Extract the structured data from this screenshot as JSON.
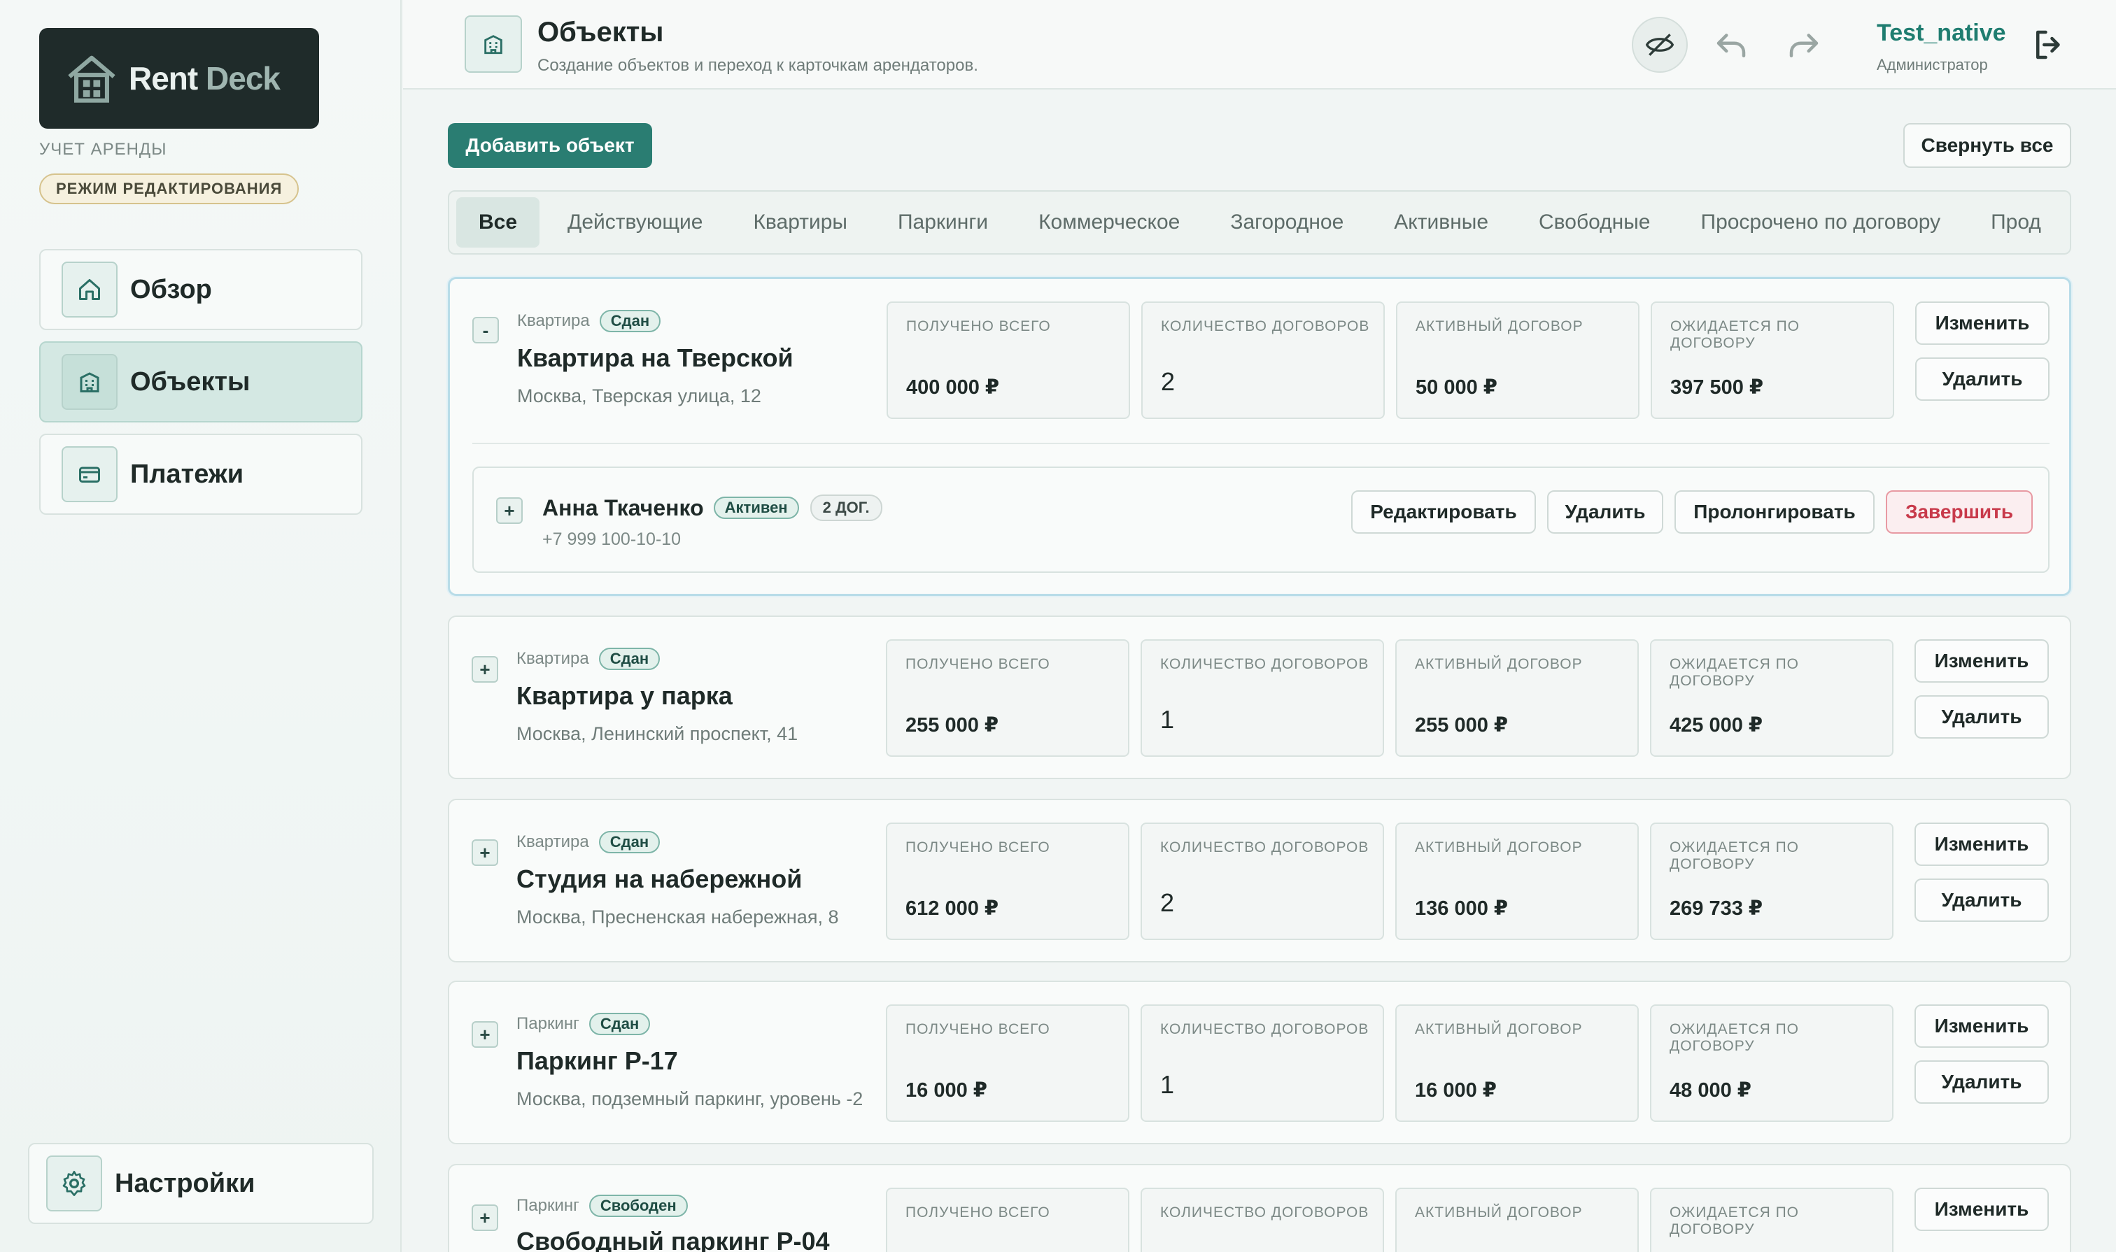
{
  "brand": {
    "name_part1": "Rent",
    "name_part2": "Deck",
    "subtitle": "УЧЕТ АРЕНДЫ",
    "mode_badge": "РЕЖИМ РЕДАКТИРОВАНИЯ"
  },
  "sidebar": {
    "items": [
      {
        "label": "Обзор",
        "icon": "home-icon"
      },
      {
        "label": "Объекты",
        "icon": "building-icon",
        "active": true
      },
      {
        "label": "Платежи",
        "icon": "card-icon"
      }
    ],
    "settings_label": "Настройки"
  },
  "header": {
    "title": "Объекты",
    "subtitle": "Создание объектов и переход к карточкам арендаторов.",
    "user_name": "Test_native",
    "user_role": "Администратор"
  },
  "toolbar": {
    "add_label": "Добавить объект",
    "collapse_label": "Свернуть все"
  },
  "filters": [
    "Все",
    "Действующие",
    "Квартиры",
    "Паркинги",
    "Коммерческое",
    "Загородное",
    "Активные",
    "Свободные",
    "Просрочено по договору",
    "Прод"
  ],
  "stat_labels": {
    "received": "ПОЛУЧЕНО ВСЕГО",
    "count": "КОЛИЧЕСТВО ДОГОВОРОВ",
    "active": "АКТИВНЫЙ ДОГОВОР",
    "expected": "ОЖИДАЕТСЯ ПО ДОГОВОРУ"
  },
  "card_actions": {
    "edit": "Изменить",
    "delete": "Удалить"
  },
  "properties": [
    {
      "toggle": "-",
      "type": "Квартира",
      "status": "Сдан",
      "name": "Квартира на Тверской",
      "address": "Москва, Тверская улица, 12",
      "received": "400 000 ₽",
      "count": "2",
      "active": "50 000 ₽",
      "expected": "397 500 ₽"
    },
    {
      "toggle": "+",
      "type": "Квартира",
      "status": "Сдан",
      "name": "Квартира у парка",
      "address": "Москва, Ленинский проспект, 41",
      "received": "255 000 ₽",
      "count": "1",
      "active": "255 000 ₽",
      "expected": "425 000 ₽"
    },
    {
      "toggle": "+",
      "type": "Квартира",
      "status": "Сдан",
      "name": "Студия на набережной",
      "address": "Москва, Пресненская набережная, 8",
      "received": "612 000 ₽",
      "count": "2",
      "active": "136 000 ₽",
      "expected": "269 733 ₽"
    },
    {
      "toggle": "+",
      "type": "Паркинг",
      "status": "Сдан",
      "name": "Паркинг P-17",
      "address": "Москва, подземный паркинг, уровень -2",
      "received": "16 000 ₽",
      "count": "1",
      "active": "16 000 ₽",
      "expected": "48 000 ₽"
    },
    {
      "toggle": "+",
      "type": "Паркинг",
      "status": "Свободен",
      "name": "Свободный паркинг P-04",
      "address": "",
      "received": "",
      "count": "",
      "active": "",
      "expected": ""
    }
  ],
  "tenant": {
    "toggle": "+",
    "name": "Анна Ткаченко",
    "status": "Активен",
    "contracts": "2 ДОГ.",
    "phone": "+7 999 100-10-10",
    "actions": {
      "edit": "Редактировать",
      "delete": "Удалить",
      "prolong": "Пролонгировать",
      "finish": "Завершить"
    }
  },
  "colors": {
    "accent": "#2a7d72",
    "danger": "#c83a4b",
    "sidebar_dark": "#1f2b2a"
  }
}
